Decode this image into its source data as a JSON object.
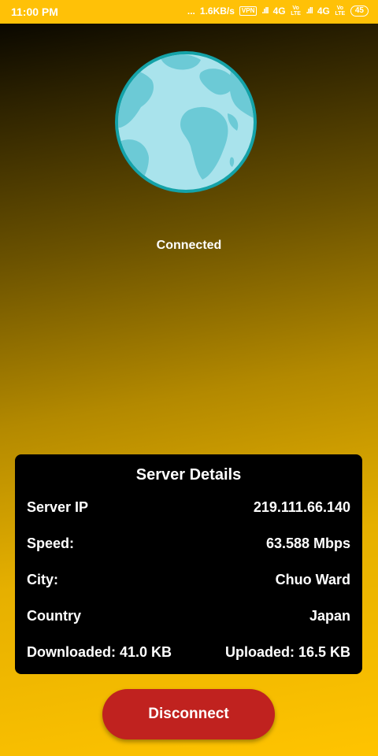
{
  "statusbar": {
    "time": "11:00 PM",
    "dots": "...",
    "speed": "1.6KB/s",
    "vpn_badge": "VPN",
    "net1": "4G",
    "net2": "4G",
    "volte": "Vo LTE",
    "battery": "45"
  },
  "connection": {
    "status": "Connected"
  },
  "server_details": {
    "title": "Server Details",
    "ip_label": "Server IP",
    "ip_value": "219.111.66.140",
    "speed_label": "Speed:",
    "speed_value": "63.588 Mbps",
    "city_label": "City:",
    "city_value": "Chuo Ward",
    "country_label": "Country",
    "country_value": "Japan",
    "downloaded": "Downloaded: 41.0 KB",
    "uploaded": "Uploaded: 16.5 KB"
  },
  "actions": {
    "disconnect_label": "Disconnect"
  },
  "colors": {
    "statusbar": "#ffc107",
    "globe_ocean": "#a9e3ec",
    "globe_land": "#6ccad6",
    "globe_ring": "#14a2a8",
    "button": "#c0221f"
  }
}
